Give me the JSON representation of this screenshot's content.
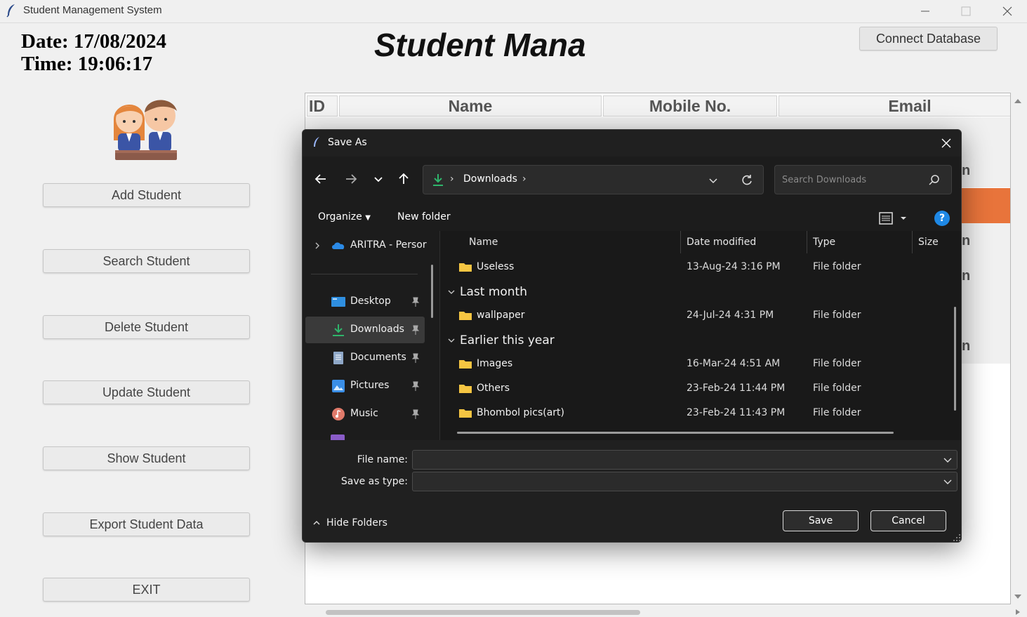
{
  "window": {
    "title": "Student Management System"
  },
  "header": {
    "date_text": "Date: 17/08/2024",
    "time_text": "Time: 19:06:17",
    "main_title": "Student Mana",
    "connect_button": "Connect Database"
  },
  "sidebar": {
    "buttons": [
      {
        "label": "Add Student"
      },
      {
        "label": "Search Student"
      },
      {
        "label": "Delete Student"
      },
      {
        "label": "Update Student"
      },
      {
        "label": "Show Student"
      },
      {
        "label": "Export Student Data"
      },
      {
        "label": "EXIT"
      }
    ]
  },
  "table": {
    "columns": [
      "ID",
      "Name",
      "Mobile No.",
      "Email"
    ],
    "selected_row_color": "#e8743b"
  },
  "dialog": {
    "title": "Save As",
    "address": {
      "crumb": "Downloads"
    },
    "search_placeholder": "Search Downloads",
    "commands": {
      "organize": "Organize",
      "new_folder": "New folder"
    },
    "nav_pane": [
      {
        "label": "ARITRA - Persor",
        "icon": "onedrive-cloud-icon"
      },
      {
        "label": "Desktop",
        "icon": "desktop-icon"
      },
      {
        "label": "Downloads",
        "icon": "downloads-icon"
      },
      {
        "label": "Documents",
        "icon": "documents-icon"
      },
      {
        "label": "Pictures",
        "icon": "pictures-icon"
      },
      {
        "label": "Music",
        "icon": "music-icon"
      }
    ],
    "columns": {
      "name": "Name",
      "date_modified": "Date modified",
      "type": "Type",
      "size": "Size"
    },
    "groups": {
      "last_month": "Last month",
      "earlier_this_year": "Earlier this year"
    },
    "files": [
      {
        "name": "Useless",
        "date": "13-Aug-24 3:16 PM",
        "type": "File folder"
      },
      {
        "name": "wallpaper",
        "date": "24-Jul-24 4:31 PM",
        "type": "File folder"
      },
      {
        "name": "Images",
        "date": "16-Mar-24 4:51 AM",
        "type": "File folder"
      },
      {
        "name": "Others",
        "date": "23-Feb-24 11:44 PM",
        "type": "File folder"
      },
      {
        "name": "Bhombol pics(art)",
        "date": "23-Feb-24 11:43 PM",
        "type": "File folder"
      }
    ],
    "file_name_label": "File name:",
    "file_name_value": "",
    "save_as_type_label": "Save as type:",
    "save_as_type_value": "",
    "hide_folders": "Hide Folders",
    "save_button": "Save",
    "cancel_button": "Cancel"
  }
}
